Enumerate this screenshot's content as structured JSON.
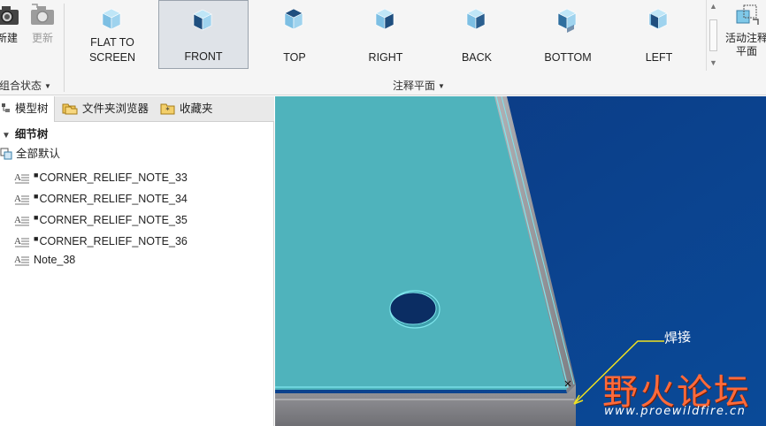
{
  "ribbon": {
    "new_label": "新建",
    "update_label": "更新",
    "combo_state_group": "组合状态",
    "annotation_plane_group": "注释平面",
    "views": [
      {
        "label": "FLAT TO\nSCREEN",
        "icon": "flat-to-screen-cube-icon",
        "selected": false
      },
      {
        "label": "FRONT",
        "icon": "front-view-cube-icon",
        "selected": true
      },
      {
        "label": "TOP",
        "icon": "top-view-cube-icon",
        "selected": false
      },
      {
        "label": "RIGHT",
        "icon": "right-view-cube-icon",
        "selected": false
      },
      {
        "label": "BACK",
        "icon": "back-view-cube-icon",
        "selected": false
      },
      {
        "label": "BOTTOM",
        "icon": "bottom-view-cube-icon",
        "selected": false
      },
      {
        "label": "LEFT",
        "icon": "left-view-cube-icon",
        "selected": false
      }
    ],
    "active_plane_label": "活动注释\n平面"
  },
  "panel": {
    "tabs": [
      {
        "label": "模型树",
        "icon": "model-tree-icon"
      },
      {
        "label": "文件夹浏览器",
        "icon": "folder-icon"
      },
      {
        "label": "收藏夹",
        "icon": "favorites-icon"
      }
    ],
    "detail_tree_header": "细节树",
    "all_default": "全部默认",
    "notes": [
      {
        "label": "CORNER_RELIEF_NOTE_33",
        "flag": true
      },
      {
        "label": "CORNER_RELIEF_NOTE_34",
        "flag": true
      },
      {
        "label": "CORNER_RELIEF_NOTE_35",
        "flag": true
      },
      {
        "label": "CORNER_RELIEF_NOTE_36",
        "flag": true
      },
      {
        "label": "Note_38",
        "flag": false
      }
    ]
  },
  "viewport": {
    "watermark_title": "野火论坛",
    "watermark_url": "www.proewildfire.cn",
    "handwritten_note": "焊接"
  },
  "colors": {
    "plate_top": "#4fb3bc",
    "plate_edge": "#69c6cf",
    "background_blue": "#0b3f87",
    "plate_side": "#8a8a8e",
    "watermark_orange": "#ff6a3a",
    "annotation_yellow": "#f2e21f"
  }
}
